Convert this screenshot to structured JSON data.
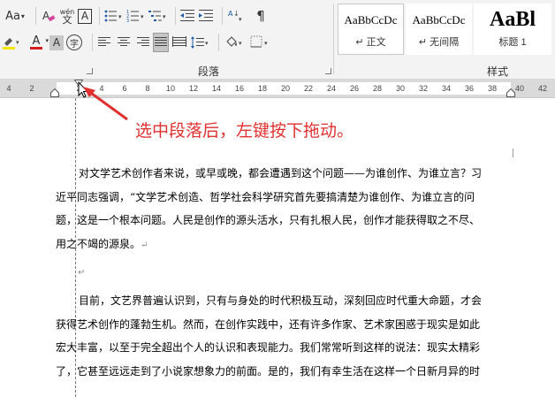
{
  "font_group": {
    "aa": "Aa",
    "pinyin": "wén",
    "char_border": "A",
    "font_color": "A",
    "char_shading": "A",
    "enclose": "字"
  },
  "paragraph": {
    "group_label": "段落"
  },
  "styles": {
    "group_label": "样式",
    "items": [
      {
        "preview": "AaBbCcDc",
        "name": "↵ 正文"
      },
      {
        "preview": "AaBbCcDc",
        "name": "↵ 无间隔"
      },
      {
        "preview": "AaBl",
        "name": "标题 1"
      }
    ]
  },
  "ruler": {
    "ticks": [
      "4",
      "2",
      "2",
      "4",
      "6",
      "8",
      "10",
      "12",
      "14",
      "16",
      "18",
      "20",
      "22",
      "24",
      "26",
      "28",
      "30",
      "32",
      "34",
      "36",
      "38",
      "40",
      "42"
    ]
  },
  "annotation": "选中段落后，左键按下拖动。",
  "document": {
    "paragraphs": [
      {
        "lines": [
          "对文学艺术创作者来说，或早或晚，都会遭遇到这个问题——为谁创作、为谁立言？习",
          "近平同志强调，“文学艺术创造、哲学社会科学研究首先要搞清楚为谁创作、为谁立言的问",
          "题，这是一个根本问题。人民是创作的源头活水，只有扎根人民，创作才能获得取之不尽、",
          "用之不竭的源泉。"
        ]
      },
      {
        "lines": [
          "目前，文艺界普遍认识到，只有与身处的时代积极互动，深刻回应时代重大命题，才会",
          "获得艺术创作的蓬勃生机。然而，在创作实践中，还有许多作家、艺术家困惑于现实是如此",
          "宏大丰富，以至于完全超出个人的认识和表现能力。我们常常听到这样的说法：现实太精彩",
          "了，它甚至远远走到了小说家想象力的前面。是的，我们有幸生活在这样一个日新月异的时"
        ]
      }
    ],
    "return_mark": "↵"
  },
  "colors": {
    "font_red": "#d42020",
    "highlight_yellow": "#f5e600",
    "annotation_red": "#e03030"
  }
}
